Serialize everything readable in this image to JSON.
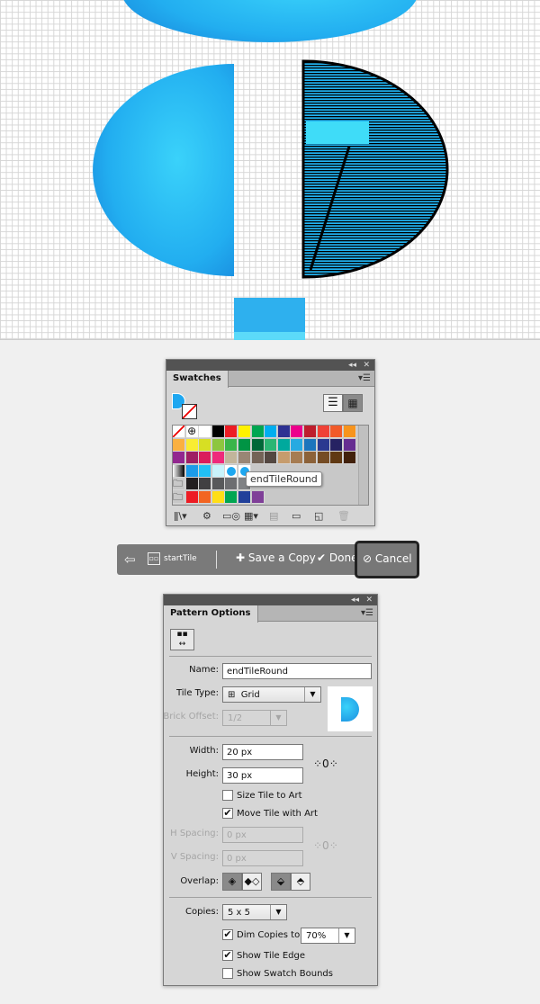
{
  "swatches": {
    "title": "Swatches",
    "tooltip": "endTileRound",
    "rows": [
      [
        "none",
        "registration",
        "#ffffff",
        "#000000",
        "#ed1c24",
        "#fff200",
        "#00a651",
        "#00aeef",
        "#2e3192",
        "#ec008c",
        "#be1e2d",
        "#ef4136",
        "#f15a29",
        "#f7941d"
      ],
      [
        "#fbb040",
        "#f9ed32",
        "#d7df23",
        "#8dc63f",
        "#39b54a",
        "#009444",
        "#006838",
        "#2bb673",
        "#00a99d",
        "#27aae1",
        "#1c75bc",
        "#2b3990",
        "#262262",
        "#662d91"
      ],
      [
        "#92278f",
        "#9e1f63",
        "#da1c5c",
        "#ee2a7b",
        "#c2b59b",
        "#998675",
        "#736357",
        "#534741",
        "#c69c6d",
        "#a67c52",
        "#8c6239",
        "#754c24",
        "#603913",
        "#42210b"
      ],
      [
        "gradient",
        "#1c9be8",
        "#21c0f5",
        "#c9f3fb",
        "pattern",
        "pattern"
      ],
      [
        "folder",
        "#231f20",
        "#414042",
        "#58595b",
        "#6d6e71",
        "#808285"
      ],
      [
        "folder",
        "#ed1c24",
        "#f26522",
        "#ffde17",
        "#00a651",
        "#21409a",
        "#7f3f98"
      ]
    ]
  },
  "pattern_bar": {
    "tile_name": "startTile",
    "save_copy": "Save a Copy",
    "done": "Done",
    "cancel": "Cancel"
  },
  "pattern_options": {
    "title": "Pattern Options",
    "name_label": "Name:",
    "name_value": "endTileRound",
    "tile_type_label": "Tile Type:",
    "tile_type_value": "Grid",
    "brick_offset_label": "Brick Offset:",
    "brick_offset_value": "1/2",
    "width_label": "Width:",
    "width_value": "20 px",
    "height_label": "Height:",
    "height_value": "30 px",
    "size_tile_to_art": {
      "label": "Size Tile to Art",
      "checked": false
    },
    "move_tile_with_art": {
      "label": "Move Tile with Art",
      "checked": true
    },
    "h_spacing_label": "H Spacing:",
    "h_spacing_value": "0 px",
    "v_spacing_label": "V Spacing:",
    "v_spacing_value": "0 px",
    "overlap_label": "Overlap:",
    "copies_label": "Copies:",
    "copies_value": "5 x 5",
    "dim_copies": {
      "label": "Dim Copies to:",
      "checked": true,
      "value": "70%"
    },
    "show_tile_edge": {
      "label": "Show Tile Edge",
      "checked": true
    },
    "show_swatch_bounds": {
      "label": "Show Swatch Bounds",
      "checked": false
    }
  },
  "colors": {
    "accent_blue": "#1ea7f0",
    "panel": "#d6d6d6"
  }
}
